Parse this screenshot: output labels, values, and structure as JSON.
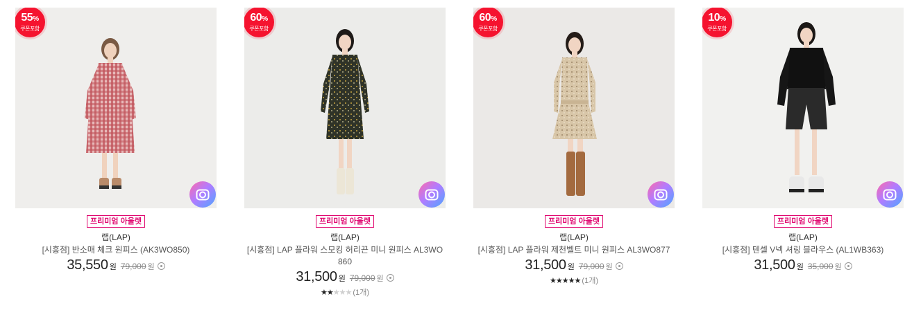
{
  "products": [
    {
      "discount": "55",
      "pct_sign": "%",
      "coupon_label": "쿠폰포함",
      "tag": "프리미엄 아울렛",
      "brand": "랩(LAP)",
      "name": "[시흥점] 반소매 체크 원피스 (AK3WO850)",
      "price": "35,550",
      "price_unit": "원",
      "original_price": "79,000",
      "original_unit": "원",
      "rating": null,
      "review_count": null
    },
    {
      "discount": "60",
      "pct_sign": "%",
      "coupon_label": "쿠폰포함",
      "tag": "프리미엄 아울렛",
      "brand": "랩(LAP)",
      "name": "[시흥점] LAP 플라워 스모킹 허리끈 미니 원피스 AL3WO860",
      "price": "31,500",
      "price_unit": "원",
      "original_price": "79,000",
      "original_unit": "원",
      "rating": 2,
      "review_count": "(1개)"
    },
    {
      "discount": "60",
      "pct_sign": "%",
      "coupon_label": "쿠폰포함",
      "tag": "프리미엄 아울렛",
      "brand": "랩(LAP)",
      "name": "[시흥점] LAP 플라워 제천벨트 미니 원피스 AL3WO877",
      "price": "31,500",
      "price_unit": "원",
      "original_price": "79,000",
      "original_unit": "원",
      "rating": 5,
      "review_count": "(1개)"
    },
    {
      "discount": "10",
      "pct_sign": "%",
      "coupon_label": "쿠폰포함",
      "tag": "프리미엄 아울렛",
      "brand": "랩(LAP)",
      "name": "[시흥점] 텐셀 V넥 셔링 블라우스 (AL1WB363)",
      "price": "31,500",
      "price_unit": "원",
      "original_price": "35,000",
      "original_unit": "원",
      "rating": null,
      "review_count": null
    }
  ],
  "icons": {
    "badge": "discount-badge",
    "lens": "camera-lens-search-icon",
    "info": "info-circle-icon",
    "star": "star-icon"
  },
  "colors": {
    "badge": "#f5132f",
    "tag": "#e0066f",
    "lens_gradient": [
      "#ff6aa8",
      "#b27bff",
      "#4fa5ff"
    ]
  }
}
